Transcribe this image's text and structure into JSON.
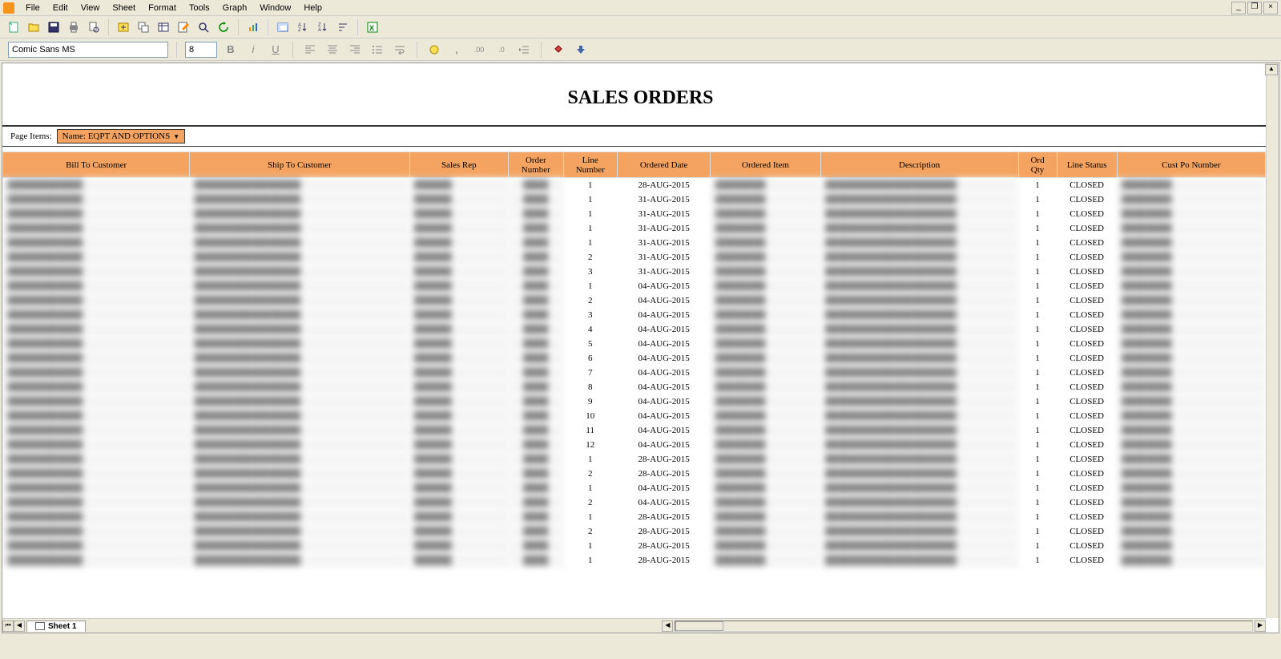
{
  "menu": {
    "items": [
      "File",
      "Edit",
      "View",
      "Sheet",
      "Format",
      "Tools",
      "Graph",
      "Window",
      "Help"
    ]
  },
  "format_toolbar": {
    "font_name": "Comic Sans MS",
    "font_size": "8"
  },
  "report": {
    "title": "SALES ORDERS",
    "page_items_label": "Page Items:",
    "page_items_value": "Name: EQPT AND OPTIONS"
  },
  "table": {
    "headers": {
      "bill_to": "Bill To Customer",
      "ship_to": "Ship To Customer",
      "sales_rep": "Sales Rep",
      "order_number": "Order Number",
      "line_number": "Line Number",
      "ordered_date": "Ordered Date",
      "ordered_item": "Ordered Item",
      "description": "Description",
      "ord_qty": "Ord Qty",
      "line_status": "Line Status",
      "cust_po": "Cust Po Number"
    },
    "rows": [
      {
        "line_number": "1",
        "ordered_date": "28-AUG-2015",
        "ord_qty": "1",
        "line_status": "CLOSED"
      },
      {
        "line_number": "1",
        "ordered_date": "31-AUG-2015",
        "ord_qty": "1",
        "line_status": "CLOSED"
      },
      {
        "line_number": "1",
        "ordered_date": "31-AUG-2015",
        "ord_qty": "1",
        "line_status": "CLOSED"
      },
      {
        "line_number": "1",
        "ordered_date": "31-AUG-2015",
        "ord_qty": "1",
        "line_status": "CLOSED"
      },
      {
        "line_number": "1",
        "ordered_date": "31-AUG-2015",
        "ord_qty": "1",
        "line_status": "CLOSED"
      },
      {
        "line_number": "2",
        "ordered_date": "31-AUG-2015",
        "ord_qty": "1",
        "line_status": "CLOSED"
      },
      {
        "line_number": "3",
        "ordered_date": "31-AUG-2015",
        "ord_qty": "1",
        "line_status": "CLOSED"
      },
      {
        "line_number": "1",
        "ordered_date": "04-AUG-2015",
        "ord_qty": "1",
        "line_status": "CLOSED"
      },
      {
        "line_number": "2",
        "ordered_date": "04-AUG-2015",
        "ord_qty": "1",
        "line_status": "CLOSED"
      },
      {
        "line_number": "3",
        "ordered_date": "04-AUG-2015",
        "ord_qty": "1",
        "line_status": "CLOSED"
      },
      {
        "line_number": "4",
        "ordered_date": "04-AUG-2015",
        "ord_qty": "1",
        "line_status": "CLOSED"
      },
      {
        "line_number": "5",
        "ordered_date": "04-AUG-2015",
        "ord_qty": "1",
        "line_status": "CLOSED"
      },
      {
        "line_number": "6",
        "ordered_date": "04-AUG-2015",
        "ord_qty": "1",
        "line_status": "CLOSED"
      },
      {
        "line_number": "7",
        "ordered_date": "04-AUG-2015",
        "ord_qty": "1",
        "line_status": "CLOSED"
      },
      {
        "line_number": "8",
        "ordered_date": "04-AUG-2015",
        "ord_qty": "1",
        "line_status": "CLOSED"
      },
      {
        "line_number": "9",
        "ordered_date": "04-AUG-2015",
        "ord_qty": "1",
        "line_status": "CLOSED"
      },
      {
        "line_number": "10",
        "ordered_date": "04-AUG-2015",
        "ord_qty": "1",
        "line_status": "CLOSED"
      },
      {
        "line_number": "11",
        "ordered_date": "04-AUG-2015",
        "ord_qty": "1",
        "line_status": "CLOSED"
      },
      {
        "line_number": "12",
        "ordered_date": "04-AUG-2015",
        "ord_qty": "1",
        "line_status": "CLOSED"
      },
      {
        "line_number": "1",
        "ordered_date": "28-AUG-2015",
        "ord_qty": "1",
        "line_status": "CLOSED"
      },
      {
        "line_number": "2",
        "ordered_date": "28-AUG-2015",
        "ord_qty": "1",
        "line_status": "CLOSED"
      },
      {
        "line_number": "1",
        "ordered_date": "04-AUG-2015",
        "ord_qty": "1",
        "line_status": "CLOSED"
      },
      {
        "line_number": "2",
        "ordered_date": "04-AUG-2015",
        "ord_qty": "1",
        "line_status": "CLOSED"
      },
      {
        "line_number": "1",
        "ordered_date": "28-AUG-2015",
        "ord_qty": "1",
        "line_status": "CLOSED"
      },
      {
        "line_number": "2",
        "ordered_date": "28-AUG-2015",
        "ord_qty": "1",
        "line_status": "CLOSED"
      },
      {
        "line_number": "1",
        "ordered_date": "28-AUG-2015",
        "ord_qty": "1",
        "line_status": "CLOSED"
      },
      {
        "line_number": "1",
        "ordered_date": "28-AUG-2015",
        "ord_qty": "1",
        "line_status": "CLOSED"
      }
    ]
  },
  "sheet_tab": "Sheet 1"
}
